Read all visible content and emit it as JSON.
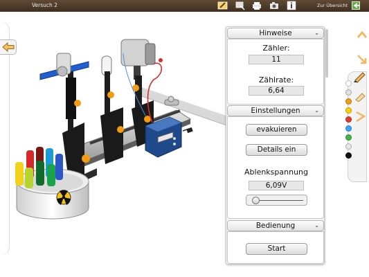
{
  "app": {
    "title": "Versuch 2",
    "overview_label": "Zur Übersicht",
    "toolbar_icons": [
      "pencil-tool-icon",
      "screen-capture-icon",
      "print-icon",
      "camera-icon",
      "info-icon"
    ]
  },
  "panel": {
    "hinweise": {
      "header": "Hinweise",
      "counter_label": "Zähler:",
      "counter_value": "11",
      "rate_label": "Zählrate:",
      "rate_value": "6,64"
    },
    "einstellungen": {
      "header": "Einstellungen",
      "evacuate_button": "evakuieren",
      "details_button": "Details ein",
      "voltage_label": "Ablenkspannung",
      "voltage_value": "6,09V",
      "voltage_slider_fraction": 0.05
    },
    "bedienung": {
      "header": "Bedienung",
      "start_button": "Start"
    }
  },
  "tools": {
    "colors": [
      "#ffffff",
      "#e0e0e0",
      "#f39c12",
      "#ffd000",
      "#e53935",
      "#3aa3ff",
      "#43b649",
      "#e8e8e8",
      "#111111"
    ]
  }
}
